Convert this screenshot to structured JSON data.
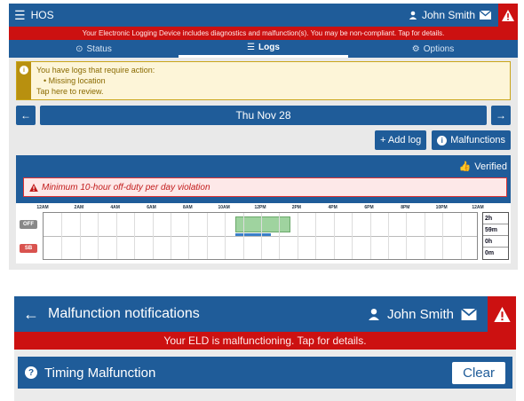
{
  "screen1": {
    "header": {
      "app_title": "HOS",
      "user_name": "John Smith"
    },
    "banner": "Your Electronic Logging Device includes diagnostics and malfunction(s). You may be non-compliant. Tap for details.",
    "tabs": [
      {
        "label": "Status",
        "icon": "clock-icon"
      },
      {
        "label": "Logs",
        "icon": "list-icon",
        "active": true
      },
      {
        "label": "Options",
        "icon": "gears-icon"
      }
    ],
    "warning": {
      "line1": "You have logs that require action:",
      "line2": "• Missing location",
      "line3": "Tap here to review."
    },
    "date": "Thu Nov 28",
    "actions": {
      "add_log": "+ Add log",
      "malfunctions": "Malfunctions"
    },
    "verified": "Verified",
    "violation": "Minimum 10-hour off-duty per day violation",
    "hours": [
      "12AM",
      "2AM",
      "4AM",
      "6AM",
      "8AM",
      "10AM",
      "12PM",
      "2PM",
      "4PM",
      "6PM",
      "8PM",
      "10PM",
      "12AM"
    ],
    "rows": [
      "OFF",
      "SB"
    ],
    "totals": [
      "2h",
      "59m",
      "0h",
      "0m"
    ],
    "colors": {
      "primary": "#1f5c99",
      "alert": "#cc1111",
      "off_block": "#9fd39f"
    }
  },
  "screen2": {
    "header": {
      "title": "Malfunction notifications",
      "user_name": "John Smith"
    },
    "banner": "Your ELD is malfunctioning. Tap for details.",
    "section": {
      "title": "Timing Malfunction",
      "clear_label": "Clear"
    }
  }
}
